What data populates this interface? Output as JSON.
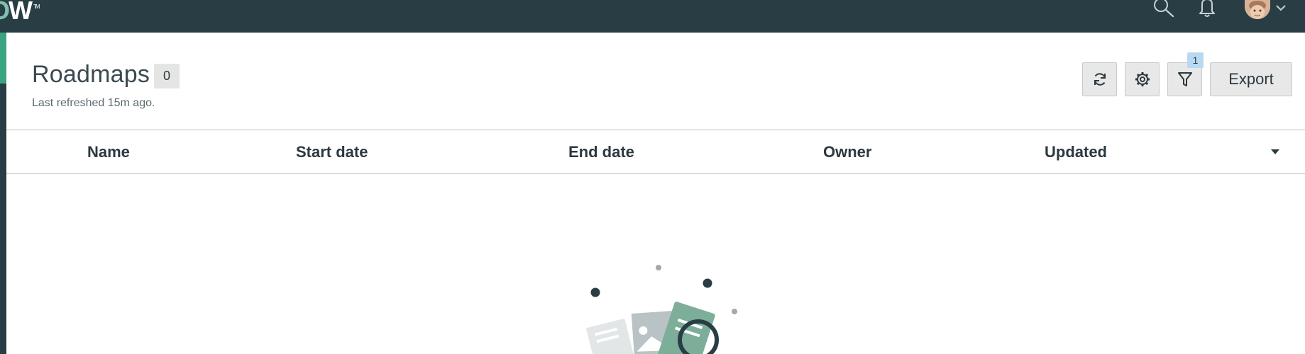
{
  "topbar": {
    "logo_text": "W",
    "logo_tm": "TM",
    "icons": [
      "search-icon",
      "bell-icon",
      "chevron-down-icon"
    ]
  },
  "page": {
    "title": "Roadmaps",
    "count": "0",
    "last_refreshed": "Last refreshed 15m ago."
  },
  "toolbar": {
    "filter_count": "1",
    "export_label": "Export",
    "icons": [
      "refresh-icon",
      "gear-icon",
      "filter-icon"
    ]
  },
  "table": {
    "columns": [
      "Name",
      "Start date",
      "End date",
      "Owner",
      "Updated"
    ],
    "sort_direction": "descending"
  },
  "colors": {
    "topbar": "#293d44",
    "accent": "#3aa482",
    "badge": "#b8daf0"
  }
}
